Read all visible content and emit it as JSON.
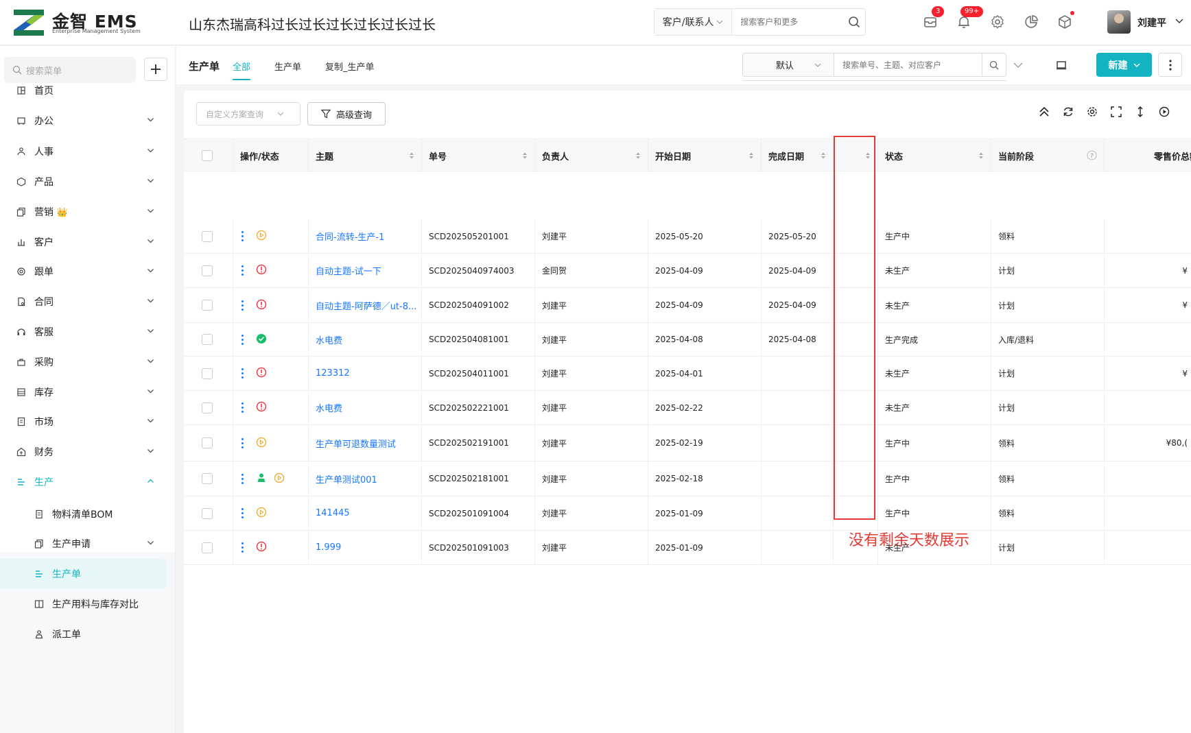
{
  "header": {
    "logo_text": "金智 EMS",
    "logo_sub": "Enterprise Management System",
    "company": "山东杰瑞高科过长过长过长过长过长过长",
    "search_scope": "客户/联系人",
    "search_placeholder": "搜索客户和更多",
    "mail_badge": "3",
    "notify_badge": "99+",
    "user_name": "刘建平",
    "colors": {
      "accent": "#13b3c4",
      "badge": "#f5222d",
      "link": "#1677ff",
      "annotation": "#e53935"
    }
  },
  "sidebar": {
    "search_placeholder": "搜索菜单",
    "items": [
      {
        "label": "首页",
        "icon": "home-icon"
      },
      {
        "label": "办公",
        "icon": "office-icon"
      },
      {
        "label": "人事",
        "icon": "hr-icon"
      },
      {
        "label": "产品",
        "icon": "product-icon"
      },
      {
        "label": "营销",
        "icon": "marketing-icon",
        "crown": "👑"
      },
      {
        "label": "客户",
        "icon": "customer-icon"
      },
      {
        "label": "跟单",
        "icon": "followup-icon"
      },
      {
        "label": "合同",
        "icon": "contract-icon"
      },
      {
        "label": "客服",
        "icon": "service-icon"
      },
      {
        "label": "采购",
        "icon": "purchase-icon"
      },
      {
        "label": "库存",
        "icon": "inventory-icon"
      },
      {
        "label": "市场",
        "icon": "market-icon"
      },
      {
        "label": "财务",
        "icon": "finance-icon"
      },
      {
        "label": "生产",
        "icon": "production-icon"
      }
    ],
    "sub_items": [
      {
        "label": "物料清单BOM",
        "icon": "bom-icon"
      },
      {
        "label": "生产申请",
        "icon": "request-icon"
      },
      {
        "label": "生产单",
        "icon": "production-order-icon"
      },
      {
        "label": "生产用料与库存对比",
        "icon": "compare-icon"
      },
      {
        "label": "派工单",
        "icon": "dispatch-icon"
      }
    ]
  },
  "tabbar": {
    "title": "生产单",
    "tabs": [
      "全部",
      "生产单",
      "复制_生产单"
    ],
    "filter_default": "默认",
    "filter_placeholder": "搜索单号、主题、对应客户",
    "new_label": "新建"
  },
  "panel": {
    "scheme_placeholder": "自定义方案查询",
    "advanced_label": "高级查询"
  },
  "table": {
    "columns": [
      "操作/状态",
      "主题",
      "单号",
      "负责人",
      "开始日期",
      "完成日期",
      "",
      "状态",
      "当前阶段",
      "零售价总额"
    ],
    "rows": [
      {
        "status_icon": "play",
        "subject": "合同-流转-生产-1",
        "no": "SCD202505201001",
        "owner": "刘建平",
        "start": "2025-05-20",
        "end": "2025-05-20",
        "days": "",
        "state": "生产中",
        "stage": "领料",
        "price": ""
      },
      {
        "status_icon": "alert",
        "subject": "自动主题-试一下",
        "no": "SCD2025040974003",
        "owner": "金同贺",
        "start": "2025-04-09",
        "end": "2025-04-09",
        "days": "",
        "state": "未生产",
        "stage": "计划",
        "price": "¥"
      },
      {
        "status_icon": "alert",
        "subject": "自动主题-阿萨德／ut-8...",
        "no": "SCD202504091002",
        "owner": "刘建平",
        "start": "2025-04-09",
        "end": "2025-04-09",
        "days": "",
        "state": "未生产",
        "stage": "计划",
        "price": "¥"
      },
      {
        "status_icon": "done",
        "subject": "水电费",
        "no": "SCD202504081001",
        "owner": "刘建平",
        "start": "2025-04-08",
        "end": "2025-04-08",
        "days": "",
        "state": "生产完成",
        "stage": "入库/退料",
        "price": ""
      },
      {
        "status_icon": "alert",
        "subject": "123312",
        "no": "SCD202504011001",
        "owner": "刘建平",
        "start": "2025-04-01",
        "end": "",
        "days": "",
        "state": "未生产",
        "stage": "计划",
        "price": "¥"
      },
      {
        "status_icon": "alert",
        "subject": "水电费",
        "no": "SCD202502221001",
        "owner": "刘建平",
        "start": "2025-02-22",
        "end": "",
        "days": "",
        "state": "未生产",
        "stage": "计划",
        "price": ""
      },
      {
        "status_icon": "play",
        "subject": "生产单可退数量测试",
        "no": "SCD202502191001",
        "owner": "刘建平",
        "start": "2025-02-19",
        "end": "",
        "days": "",
        "state": "生产中",
        "stage": "领料",
        "price": "¥80,("
      },
      {
        "status_icon": "person-play",
        "subject": "生产单测试001",
        "no": "SCD202502181001",
        "owner": "刘建平",
        "start": "2025-02-18",
        "end": "",
        "days": "",
        "state": "生产中",
        "stage": "领料",
        "price": ""
      },
      {
        "status_icon": "play",
        "subject": "141445",
        "no": "SCD202501091004",
        "owner": "刘建平",
        "start": "2025-01-09",
        "end": "",
        "days": "",
        "state": "生产中",
        "stage": "领料",
        "price": ""
      },
      {
        "status_icon": "alert",
        "subject": "1.999",
        "no": "SCD202501091003",
        "owner": "刘建平",
        "start": "2025-01-09",
        "end": "",
        "days": "",
        "state": "未生产",
        "stage": "计划",
        "price": ""
      }
    ]
  },
  "annotation": "没有剩余天数展示"
}
